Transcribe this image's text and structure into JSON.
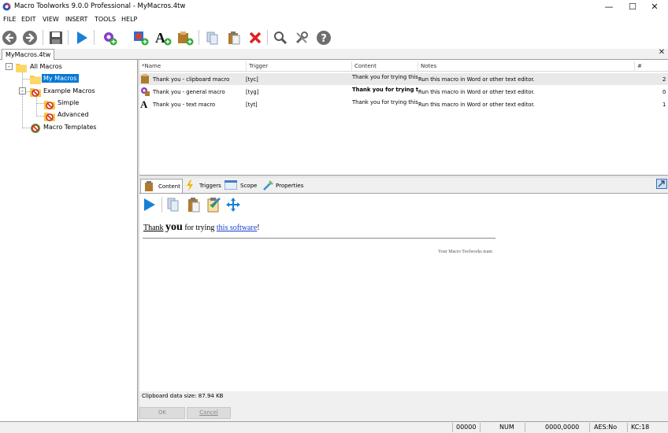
{
  "window": {
    "title": "Macro Toolworks 9.0.0 Professional - MyMacros.4tw",
    "minimize": "—",
    "maximize": "☐",
    "close": "✕"
  },
  "menu": [
    "FILE",
    "EDIT",
    "VIEW",
    "INSERT",
    "TOOLS",
    "HELP"
  ],
  "toolbar": {
    "buttons": [
      "back-icon",
      "forward-icon",
      "save-icon",
      "run-icon",
      "new-macro-icon",
      "new-trigger-icon",
      "new-text-macro-icon",
      "new-clipboard-macro-icon",
      "copy-icon",
      "paste-icon",
      "delete-icon",
      "search-icon",
      "tools-icon",
      "help-icon"
    ]
  },
  "document_tab": "MyMacros.4tw",
  "tree": {
    "items": [
      {
        "label": "All Macros"
      },
      {
        "label": "My Macros"
      },
      {
        "label": "Example Macros"
      },
      {
        "label": "Simple"
      },
      {
        "label": "Advanced"
      },
      {
        "label": "Macro Templates"
      }
    ]
  },
  "macro_list": {
    "columns": [
      "*Name",
      "Trigger",
      "Content",
      "Notes",
      "#"
    ],
    "rows": [
      {
        "name": "Thank you - clipboard macro",
        "trigger": "[tyc]",
        "content": "Thank you for trying this s...",
        "notes": "Run this macro in Word or other text editor.",
        "count": "2"
      },
      {
        "name": "Thank you - general macro",
        "trigger": "[tyg]",
        "content": "Thank you for trying thi...",
        "notes": "Run this macro in Word or other text editor.",
        "count": "0"
      },
      {
        "name": "Thank you - text macro",
        "trigger": "[tyt]",
        "content": "Thank you for trying this s...",
        "notes": "Run this macro in Word or other text editor.",
        "count": "1"
      }
    ]
  },
  "panel_tabs": [
    "Content",
    "Triggers",
    "Scope",
    "Properties"
  ],
  "editor": {
    "word1": "Thank",
    "word2": "you",
    "word3": "for trying",
    "link": "this software",
    "end": "!",
    "signature": "Your Macro Toolworks team"
  },
  "clipboard_size": "Clipboard data size: 87.94 KB",
  "buttons": {
    "ok": "OK",
    "cancel": "Cancel"
  },
  "status": {
    "pos": "00000",
    "num": "NUM",
    "coords": "0000,0000",
    "aes": "AES:No",
    "kc": "KC:18"
  },
  "colors": {
    "accent": "#2060c8",
    "selection": "#0078d7",
    "delete": "#e02020"
  }
}
